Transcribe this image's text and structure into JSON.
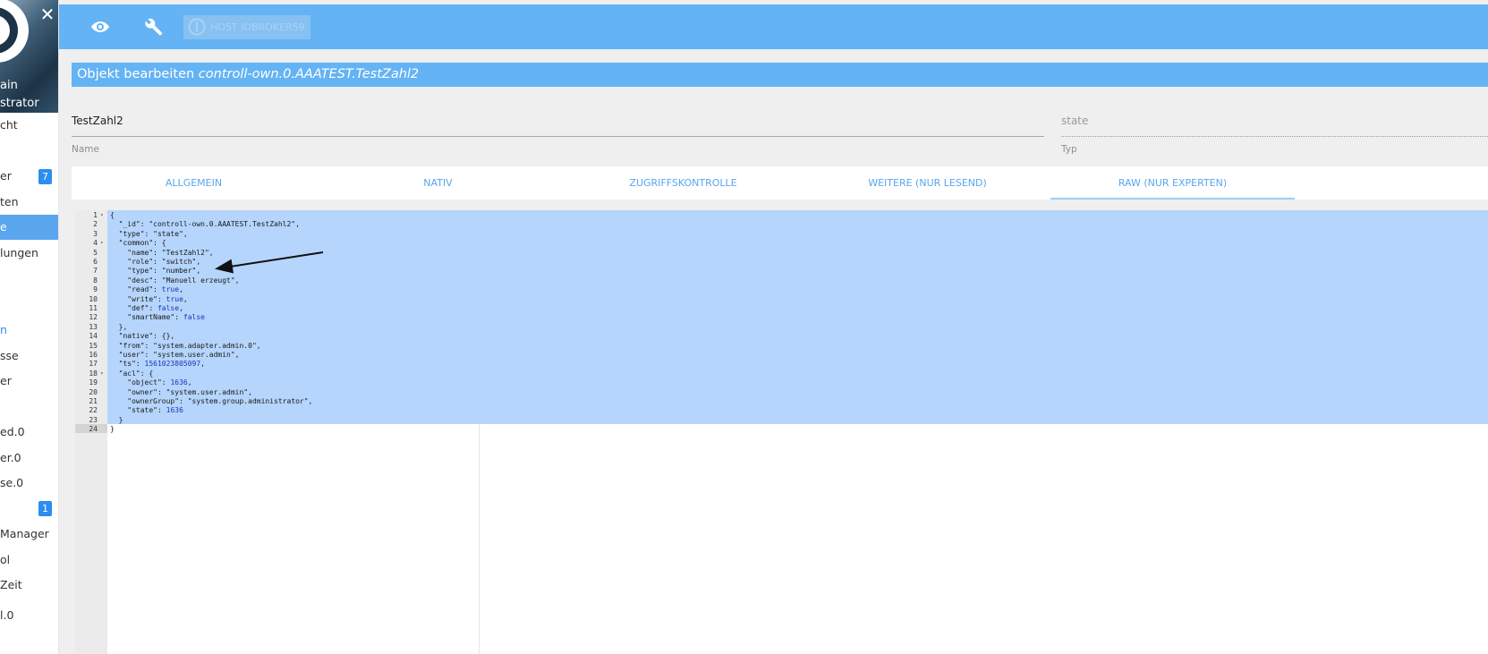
{
  "sidebar": {
    "user_name_fragment": "ain",
    "user_role_fragment": "strator",
    "items": [
      {
        "label": "cht",
        "active": false
      },
      {
        "label": "er",
        "active": false,
        "badge": "7"
      },
      {
        "label": "ten",
        "active": false
      },
      {
        "label": "e",
        "active": true
      },
      {
        "label": "lungen",
        "active": false
      },
      {
        "label": "",
        "active": false
      },
      {
        "label": "n",
        "active": false
      },
      {
        "label": "sse",
        "active": false
      },
      {
        "label": "er",
        "active": false
      },
      {
        "label": "ed.0",
        "active": false
      },
      {
        "label": "er.0",
        "active": false
      },
      {
        "label": "se.0",
        "active": false
      },
      {
        "label": "",
        "active": false,
        "badge": "1"
      },
      {
        "label": "Manager",
        "active": false
      },
      {
        "label": "ol",
        "active": false
      },
      {
        "label": "Zeit",
        "active": false
      },
      {
        "label": "l.0",
        "active": false
      }
    ]
  },
  "topbar": {
    "host_label": "HOST IOBROKER59"
  },
  "dialog": {
    "title_prefix": "Objekt bearbeiten",
    "title_id": "controll-own.0.AAATEST.TestZahl2",
    "name_value": "TestZahl2",
    "name_label": "Name",
    "type_value": "state",
    "type_label": "Typ"
  },
  "tabs": [
    {
      "label": "ALLGEMEIN",
      "active": false
    },
    {
      "label": "NATIV",
      "active": false
    },
    {
      "label": "ZUGRIFFSKONTROLLE",
      "active": false
    },
    {
      "label": "WEITERE (NUR LESEND)",
      "active": false
    },
    {
      "label": "RAW (NUR EXPERTEN)",
      "active": true
    }
  ],
  "editor": {
    "line_numbers": [
      "1",
      "2",
      "3",
      "4",
      "5",
      "6",
      "7",
      "8",
      "9",
      "10",
      "11",
      "12",
      "13",
      "14",
      "15",
      "16",
      "17",
      "18",
      "19",
      "20",
      "21",
      "22",
      "23",
      "24"
    ],
    "lines": [
      "{",
      "  \"_id\": \"controll-own.0.AAATEST.TestZahl2\",",
      "  \"type\": \"state\",",
      "  \"common\": {",
      "    \"name\": \"TestZahl2\",",
      "    \"role\": \"switch\",",
      "    \"type\": \"number\",",
      "    \"desc\": \"Manuell erzeugt\",",
      "    \"read\": true,",
      "    \"write\": true,",
      "    \"def\": false,",
      "    \"smartName\": false",
      "  },",
      "  \"native\": {},",
      "  \"from\": \"system.adapter.admin.0\",",
      "  \"user\": \"system.user.admin\",",
      "  \"ts\": 1561023805097,",
      "  \"acl\": {",
      "    \"object\": 1636,",
      "    \"owner\": \"system.user.admin\",",
      "    \"ownerGroup\": \"system.group.administrator\",",
      "    \"state\": 1636",
      "  }",
      "}"
    ],
    "fold_marker": "▾"
  },
  "colors": {
    "accent": "#64b3f4",
    "selection": "#b5d5fc",
    "tab_text": "#5aa6ef"
  }
}
